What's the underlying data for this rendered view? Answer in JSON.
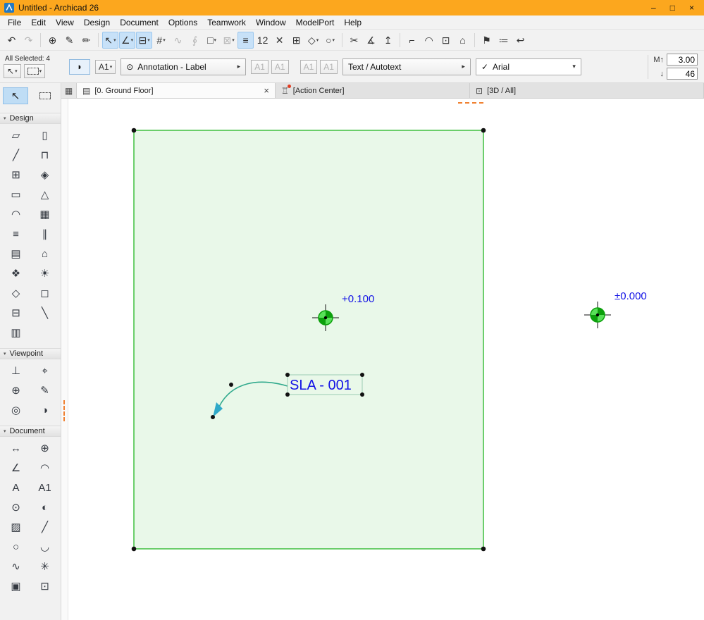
{
  "window": {
    "title": "Untitled - Archicad 26"
  },
  "icons": {
    "minimize": "–",
    "maximize": "□",
    "close": "×",
    "caret_down": "▾",
    "expand_right": "▸",
    "check": "✓",
    "eye": "⊙"
  },
  "colors": {
    "titlebar_orange": "#FCA71E",
    "selection_highlight_blue": "#C7E1F8",
    "slab_fill_green": "#E9F8E9",
    "slab_stroke_green": "#3FBF3F",
    "marker_green": "#58E058",
    "label_blue": "#1414E6",
    "leader_teal": "#2FA98C",
    "arrow_cyan": "#2FA9C9",
    "attention_orange": "#F08030"
  },
  "menu_bar": {
    "items": [
      "File",
      "Edit",
      "View",
      "Design",
      "Document",
      "Options",
      "Teamwork",
      "Window",
      "ModelPort",
      "Help"
    ]
  },
  "toolbar_main": {
    "items": [
      {
        "name": "undo",
        "glyph": "↶"
      },
      {
        "name": "redo",
        "glyph": "↷",
        "state": "disabled"
      },
      {
        "sep": true
      },
      {
        "name": "find-select",
        "glyph": "⊕"
      },
      {
        "name": "pick-up-parameters",
        "glyph": "✎"
      },
      {
        "name": "inject-parameters",
        "glyph": "✏"
      },
      {
        "sep": true
      },
      {
        "name": "arrow-tool",
        "glyph": "↖",
        "caret": true,
        "state": "active"
      },
      {
        "name": "guide-lines",
        "glyph": "∠",
        "caret": true,
        "state": "active"
      },
      {
        "name": "snap-guides",
        "glyph": "⊟",
        "caret": true,
        "state": "active"
      },
      {
        "name": "snap-grid",
        "glyph": "#",
        "caret": true
      },
      {
        "name": "gravity",
        "glyph": "∿",
        "state": "disabled"
      },
      {
        "name": "magnet",
        "glyph": "∮",
        "state": "disabled"
      },
      {
        "name": "marquee-options",
        "glyph": "□",
        "caret": true
      },
      {
        "name": "lock",
        "glyph": "⊠",
        "caret": true,
        "state": "disabled"
      },
      {
        "name": "trace-reference",
        "glyph": "≡",
        "state": "active"
      },
      {
        "name": "dimension-preview",
        "glyph": "12"
      },
      {
        "name": "suspend-groups",
        "glyph": "✕"
      },
      {
        "name": "stretch",
        "glyph": "⊞"
      },
      {
        "name": "renovation-filter",
        "glyph": "◇",
        "caret": true
      },
      {
        "name": "pen-sets",
        "glyph": "○",
        "caret": true
      },
      {
        "sep": true
      },
      {
        "name": "split",
        "glyph": "✂"
      },
      {
        "name": "adjust",
        "glyph": "∡"
      },
      {
        "name": "align",
        "glyph": "↥"
      },
      {
        "sep": true
      },
      {
        "name": "trim",
        "glyph": "⌐"
      },
      {
        "name": "fillet",
        "glyph": "◠"
      },
      {
        "name": "resize",
        "glyph": "⊡"
      },
      {
        "name": "fit-in-window",
        "glyph": "⌂"
      },
      {
        "sep": true
      },
      {
        "name": "flag",
        "glyph": "⚑"
      },
      {
        "name": "element-information",
        "glyph": "≔"
      },
      {
        "name": "go-back",
        "glyph": "↩"
      }
    ]
  },
  "info_bar": {
    "selection_status": "All Selected: 4",
    "quick_select": [
      {
        "name": "arrow-preset",
        "glyph": "↖"
      },
      {
        "name": "marquee-preset",
        "shape": "dashed-rect"
      }
    ],
    "current_tool_glyph": "◗",
    "label_style_glyph": "A1",
    "annotation_dropdown": "Annotation - Label",
    "pointer_buttons": [
      {
        "name": "symbol-label",
        "glyph": "A1"
      },
      {
        "name": "text-label",
        "glyph": "A1"
      },
      {
        "name": "pointer-on",
        "glyph": "A1"
      },
      {
        "name": "pointer-off",
        "glyph": "A1"
      }
    ],
    "text_autotext_dropdown": "Text / Autotext",
    "font_name": "Arial",
    "height_icon": "M↑",
    "arrow_icon": "↓",
    "text_height": "3.00",
    "text_size": "46"
  },
  "tab_bar": {
    "tabs": [
      {
        "label": "[0. Ground Floor]",
        "icon": "folder",
        "glyph": "▤",
        "active": true,
        "closable": true
      },
      {
        "label": "[Action Center]",
        "icon": "lighthouse",
        "glyph": "♖",
        "alert": true
      },
      {
        "label": "[3D / All]",
        "icon": "3d-view",
        "glyph": "⊡"
      }
    ]
  },
  "toolbox": {
    "top_tools": [
      {
        "name": "arrow-tool",
        "glyph": "↖",
        "active": true
      },
      {
        "name": "marquee-tool",
        "shape": "dashed-rect"
      }
    ],
    "sections": [
      {
        "title": "Design",
        "items": [
          {
            "name": "wall",
            "glyph": "▱"
          },
          {
            "name": "column",
            "glyph": "▯"
          },
          {
            "name": "beam",
            "glyph": "╱"
          },
          {
            "name": "door",
            "glyph": "⊓"
          },
          {
            "name": "window",
            "glyph": "⊞"
          },
          {
            "name": "skylight",
            "glyph": "◈"
          },
          {
            "name": "slab",
            "glyph": "▭"
          },
          {
            "name": "roof",
            "glyph": "△"
          },
          {
            "name": "shell",
            "glyph": "◠"
          },
          {
            "name": "mesh",
            "glyph": "▦"
          },
          {
            "name": "stair",
            "glyph": "≡"
          },
          {
            "name": "railing",
            "glyph": "∥"
          },
          {
            "name": "curtain-wall",
            "glyph": "▤"
          },
          {
            "name": "zone",
            "glyph": "⌂"
          },
          {
            "name": "object",
            "glyph": "❖"
          },
          {
            "name": "lamp",
            "glyph": "☀"
          },
          {
            "name": "morph",
            "glyph": "◇"
          },
          {
            "name": "opening",
            "glyph": "◻"
          },
          {
            "name": "corner-window",
            "glyph": "⊟"
          },
          {
            "name": "end-wall",
            "glyph": "╲"
          },
          {
            "name": "curtain-wall-panel",
            "glyph": "▥"
          }
        ]
      },
      {
        "title": "Viewpoint",
        "items": [
          {
            "name": "section",
            "glyph": "⊥"
          },
          {
            "name": "elevation",
            "glyph": "⌖"
          },
          {
            "name": "interior-elevation",
            "glyph": "⊕"
          },
          {
            "name": "worksheet",
            "glyph": "✎"
          },
          {
            "name": "detail",
            "glyph": "◎"
          },
          {
            "name": "3d-document",
            "glyph": "◑"
          }
        ]
      },
      {
        "title": "Document",
        "items": [
          {
            "name": "dimension",
            "glyph": "↔"
          },
          {
            "name": "level-dimension",
            "glyph": "⊕"
          },
          {
            "name": "angle-dimension",
            "glyph": "∠"
          },
          {
            "name": "radial-dimension",
            "glyph": "◠"
          },
          {
            "name": "text",
            "glyph": "A"
          },
          {
            "name": "label",
            "glyph": "A1"
          },
          {
            "name": "camera",
            "glyph": "⊙"
          },
          {
            "name": "marker",
            "glyph": "◐"
          },
          {
            "name": "fill",
            "glyph": "▨"
          },
          {
            "name": "line",
            "glyph": "╱"
          },
          {
            "name": "circle",
            "glyph": "○"
          },
          {
            "name": "arc",
            "glyph": "◡"
          },
          {
            "name": "spline",
            "glyph": "∿"
          },
          {
            "name": "hotspot",
            "glyph": "✳"
          },
          {
            "name": "figure",
            "glyph": "▣"
          },
          {
            "name": "drawing",
            "glyph": "⊡"
          }
        ]
      }
    ]
  },
  "canvas": {
    "level_markers": [
      {
        "label": "+0.100"
      },
      {
        "label": "±0.000"
      }
    ],
    "label": {
      "text": "SLA - 001"
    }
  }
}
